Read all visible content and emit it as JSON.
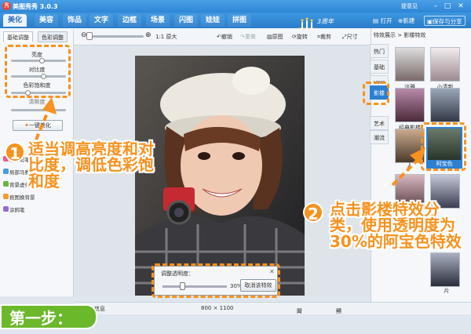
{
  "window": {
    "title": "美图秀秀 3.0.3",
    "username": "提意见",
    "controls": [
      "–",
      "□",
      "✕"
    ]
  },
  "menu": {
    "tabs": [
      "美化",
      "美容",
      "饰品",
      "文字",
      "边框",
      "场景",
      "闪图",
      "娃娃",
      "拼图"
    ],
    "active": "美化",
    "open": "打开",
    "new": "新建",
    "save": "保存与分享",
    "anniversary": "3周年"
  },
  "toolbar": {
    "actual_size": "1:1 原大",
    "undo": "撤销",
    "redo": "重做",
    "original": "原图",
    "rotate": "旋转",
    "crop": "裁剪",
    "resize": "尺寸"
  },
  "left_panel": {
    "tabs": [
      "基础调整",
      "色彩调整"
    ],
    "sliders": [
      {
        "label": "亮度",
        "value": 0.55
      },
      {
        "label": "对比度",
        "value": 0.58
      },
      {
        "label": "色彩饱和度",
        "value": 0.3
      }
    ],
    "sharpen_label": "清晰度",
    "onekey_button": "一键美化",
    "side_items": [
      "局部彩笔",
      "局部马赛克",
      "背景虚化",
      "抠图换背景",
      "涂鸦笔"
    ]
  },
  "transparency_dialog": {
    "title": "调整透明度：",
    "value_label": "30%",
    "value": 0.3,
    "cancel_button": "取消该特效"
  },
  "right_panel": {
    "title": "特效展示 > 影楼特效",
    "categories": [
      "热门",
      "基础",
      "LOMO",
      "影楼",
      "艺术",
      "潮流"
    ],
    "active_category": "影楼",
    "effects": [
      {
        "label": "淡雅"
      },
      {
        "label": "小清新"
      },
      {
        "label": "经典影楼"
      },
      {
        "label": ""
      },
      {
        "label": "人"
      },
      {
        "label": "阿宝色"
      },
      {
        "label": ""
      },
      {
        "label": ""
      },
      {
        "label": ""
      },
      {
        "label": "片"
      }
    ],
    "selected_effect": "阿宝色"
  },
  "statusbar": {
    "info": "显示信息",
    "dimensions": "800 × 1100",
    "compare": "对比",
    "preview": "预览"
  },
  "annotations": {
    "step1_number": "1",
    "step1_text": "适当调高亮度和对比度，调低色彩饱和度",
    "step2_number": "2",
    "step2_text": "点击影楼特效分类，使用透明度为30%的阿宝色特效",
    "step_label": "第一步："
  },
  "colors": {
    "title_bar": "#2f86d6",
    "accent_orange": "#f7921e",
    "step_green": "#6bb82a",
    "active_category": "#2d7fd0"
  }
}
